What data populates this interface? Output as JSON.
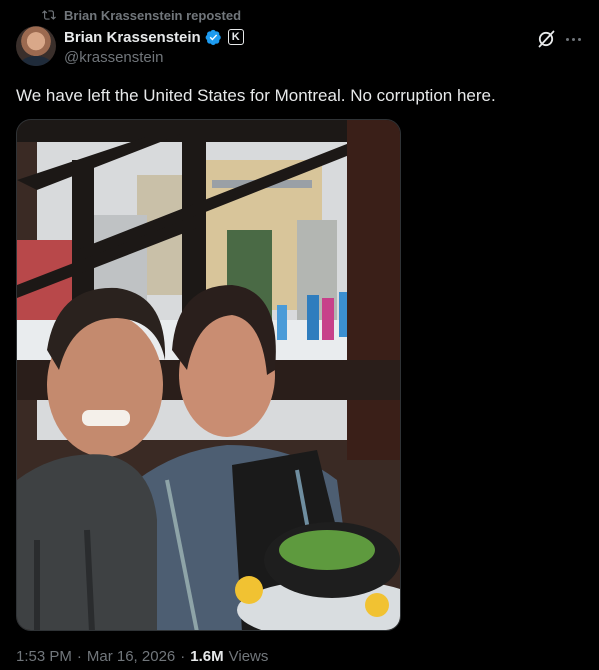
{
  "repost": {
    "label": "Brian Krassenstein reposted",
    "icon": "repost-icon"
  },
  "author": {
    "display_name": "Brian Krassenstein",
    "handle": "@krassenstein",
    "affiliation_badge": "K",
    "verified_color": "#1d9bf0"
  },
  "tweet": {
    "text": "We have left the United States for Montreal. No corruption here."
  },
  "meta": {
    "time": "1:53 PM",
    "separator": "·",
    "date": "Mar 16, 2026",
    "views_count": "1.6M",
    "views_label": "Views"
  },
  "colors": {
    "background": "#000000",
    "primary_text": "#e7e9ea",
    "secondary_text": "#71767b",
    "accent": "#1d9bf0"
  }
}
